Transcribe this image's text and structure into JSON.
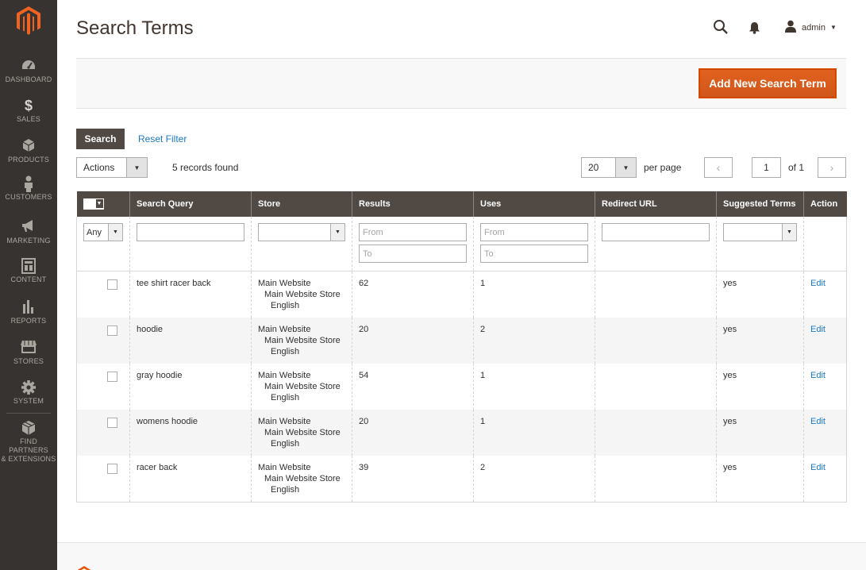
{
  "sidebar": {
    "logo_icon": "magento-logo-icon",
    "items": [
      {
        "label": "DASHBOARD",
        "icon": "speedometer-icon"
      },
      {
        "label": "SALES",
        "icon": "dollar-icon"
      },
      {
        "label": "PRODUCTS",
        "icon": "cube-icon"
      },
      {
        "label": "CUSTOMERS",
        "icon": "person-icon"
      },
      {
        "label": "MARKETING",
        "icon": "megaphone-icon"
      },
      {
        "label": "CONTENT",
        "icon": "layout-icon"
      },
      {
        "label": "REPORTS",
        "icon": "bar-chart-icon"
      },
      {
        "label": "STORES",
        "icon": "storefront-icon"
      },
      {
        "label": "SYSTEM",
        "icon": "gear-icon"
      },
      {
        "label": "FIND PARTNERS",
        "label2": "& EXTENSIONS",
        "icon": "box-icon"
      }
    ]
  },
  "header": {
    "title": "Search Terms",
    "user": "admin"
  },
  "actions": {
    "add_button": "Add New Search Term"
  },
  "toolbar": {
    "search_button": "Search",
    "reset_filter": "Reset Filter",
    "mass_actions": "Actions",
    "records_found": "5 records found",
    "per_page_value": "20",
    "per_page_label": "per page",
    "page_value": "1",
    "page_of": "of 1"
  },
  "grid": {
    "columns": [
      "Search Query",
      "Store",
      "Results",
      "Uses",
      "Redirect URL",
      "Suggested Terms",
      "Action"
    ],
    "filters": {
      "mass_select": "Any",
      "from_placeholder": "From",
      "to_placeholder": "To"
    },
    "rows": [
      {
        "query": "tee shirt racer back",
        "store1": "Main Website",
        "store2": "Main Website Store",
        "store3": "English",
        "results": "62",
        "uses": "1",
        "redirect": "",
        "suggested": "yes",
        "action": "Edit"
      },
      {
        "query": "hoodie",
        "store1": "Main Website",
        "store2": "Main Website Store",
        "store3": "English",
        "results": "20",
        "uses": "2",
        "redirect": "",
        "suggested": "yes",
        "action": "Edit"
      },
      {
        "query": "gray hoodie",
        "store1": "Main Website",
        "store2": "Main Website Store",
        "store3": "English",
        "results": "54",
        "uses": "1",
        "redirect": "",
        "suggested": "yes",
        "action": "Edit"
      },
      {
        "query": "womens hoodie",
        "store1": "Main Website",
        "store2": "Main Website Store",
        "store3": "English",
        "results": "20",
        "uses": "1",
        "redirect": "",
        "suggested": "yes",
        "action": "Edit"
      },
      {
        "query": "racer back",
        "store1": "Main Website",
        "store2": "Main Website Store",
        "store3": "English",
        "results": "39",
        "uses": "2",
        "redirect": "",
        "suggested": "yes",
        "action": "Edit"
      }
    ]
  },
  "colors": {
    "sidebar_bg": "#373330",
    "accent": "#eb5202",
    "grid_header": "#514943",
    "link": "#1979c3"
  }
}
